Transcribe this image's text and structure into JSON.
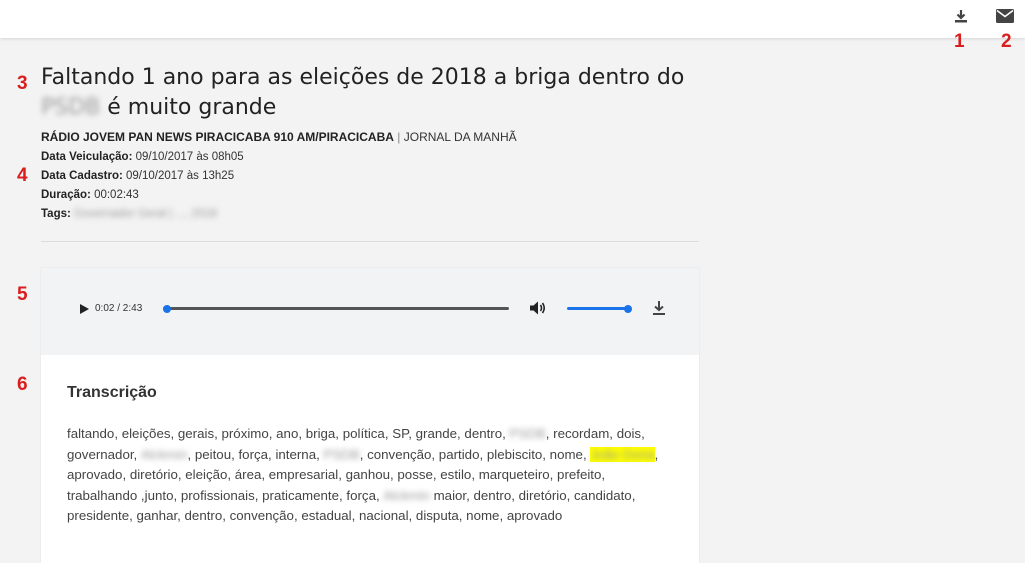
{
  "markers": [
    "1",
    "2",
    "3",
    "4",
    "5",
    "6"
  ],
  "header": {
    "title_prefix": "Faltando 1 ano para as eleições de 2018 a briga dentro do",
    "title_redacted": "PSDB",
    "title_suffix": "é muito grande"
  },
  "source": {
    "station": "RÁDIO JOVEM PAN NEWS PIRACICABA 910 AM/PIRACICABA",
    "separator": "|",
    "program": "JORNAL DA MANHÃ"
  },
  "meta": {
    "veiculacao_label": "Data Veiculação:",
    "veiculacao_value": "09/10/2017 às 08h05",
    "cadastro_label": "Data Cadastro:",
    "cadastro_value": "09/10/2017 às 13h25",
    "duracao_label": "Duração:",
    "duracao_value": "00:02:43",
    "tags_label": "Tags:",
    "tags_value": "Governador Geral | ..., 2018"
  },
  "player": {
    "time": "0:02 / 2:43",
    "progress": 0.012,
    "volume": 1.0
  },
  "transcription": {
    "title": "Transcrição",
    "part1": "faltando, eleições, gerais, próximo, ano, briga, política, SP, grande, dentro,",
    "redacted1": "PSDB",
    "part2": ", recordam, dois, governador,",
    "redacted2": "Alckmin",
    "part3": ", peitou, força, interna,",
    "redacted3": "PSDB",
    "part4": ", convenção, partido, plebiscito, nome,",
    "highlight": "João Doria",
    "part5": ", aprovado, diretório, eleição, área, empresarial, ganhou, posse, estilo, marqueteiro, prefeito, trabalhando ,junto, profissionais, praticamente, força,",
    "redacted4": "Alckmin",
    "part6": "maior, dentro, diretório, candidato, presidente, ganhar, dentro, convenção, estadual, nacional, disputa, nome, aprovado"
  },
  "colors": {
    "marker": "#d81e1e",
    "accent": "#1a73e8",
    "highlight": "#ffff00"
  }
}
